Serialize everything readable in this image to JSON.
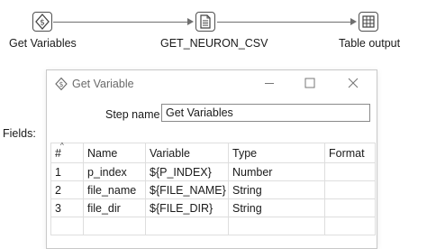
{
  "pipeline": {
    "steps": [
      {
        "label": "Get Variables",
        "icon": "get-variables-icon"
      },
      {
        "label": "GET_NEURON_CSV",
        "icon": "csv-file-input-icon"
      },
      {
        "label": "Table output",
        "icon": "table-output-icon"
      }
    ]
  },
  "dialog": {
    "title": "Get Variable",
    "minimize_icon": "minimize-icon",
    "maximize_icon": "maximize-icon",
    "close_icon": "close-icon",
    "step_name_label": "Step name",
    "step_name_value": "Get Variables",
    "fields_label": "Fields:",
    "table": {
      "sort_indicator": "^",
      "columns": [
        "#",
        "Name",
        "Variable",
        "Type",
        "Format"
      ],
      "rows": [
        [
          "1",
          "p_index",
          "${P_INDEX}",
          "Number",
          ""
        ],
        [
          "2",
          "file_name",
          "${FILE_NAME}",
          "String",
          ""
        ],
        [
          "3",
          "file_dir",
          "${FILE_DIR}",
          "String",
          ""
        ],
        [
          "",
          "",
          "",
          "",
          ""
        ]
      ]
    }
  }
}
